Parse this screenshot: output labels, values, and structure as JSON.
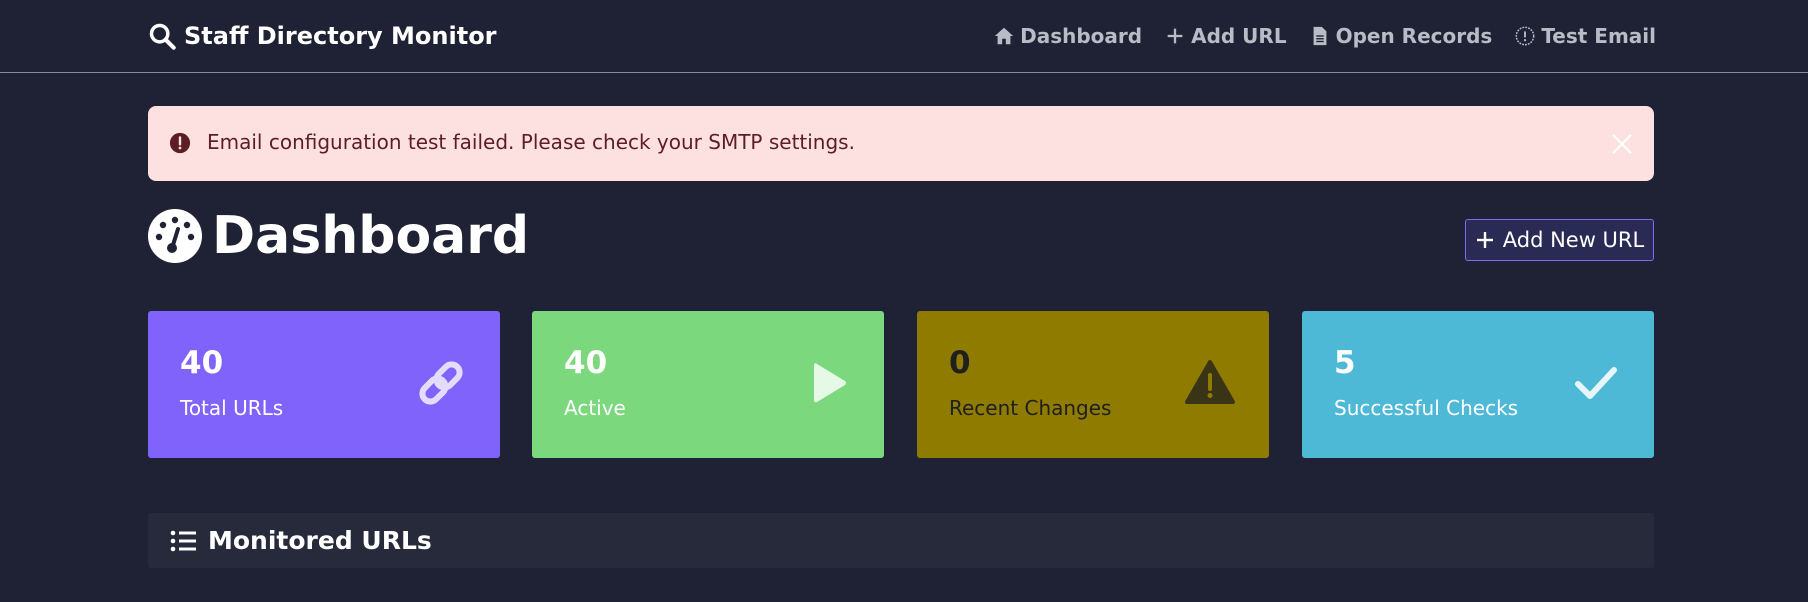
{
  "navbar": {
    "brand": "Staff Directory Monitor",
    "links": [
      {
        "label": "Dashboard",
        "icon": "home-icon"
      },
      {
        "label": "Add URL",
        "icon": "plus-icon"
      },
      {
        "label": "Open Records",
        "icon": "file-icon"
      },
      {
        "label": "Test Email",
        "icon": "exclamation-circle-icon"
      }
    ]
  },
  "alert": {
    "message": "Email configuration test failed. Please check your SMTP settings.",
    "type": "danger"
  },
  "page": {
    "title": "Dashboard",
    "add_button": "Add New URL"
  },
  "stats": [
    {
      "value": "40",
      "label": "Total URLs",
      "icon": "link-icon",
      "color": "#7f63fb"
    },
    {
      "value": "40",
      "label": "Active",
      "icon": "play-icon",
      "color": "#7bd87d"
    },
    {
      "value": "0",
      "label": "Recent Changes",
      "icon": "warning-icon",
      "color": "#8e7b00"
    },
    {
      "value": "5",
      "label": "Successful Checks",
      "icon": "check-icon",
      "color": "#4db9d7"
    }
  ],
  "panel": {
    "title": "Monitored URLs"
  }
}
